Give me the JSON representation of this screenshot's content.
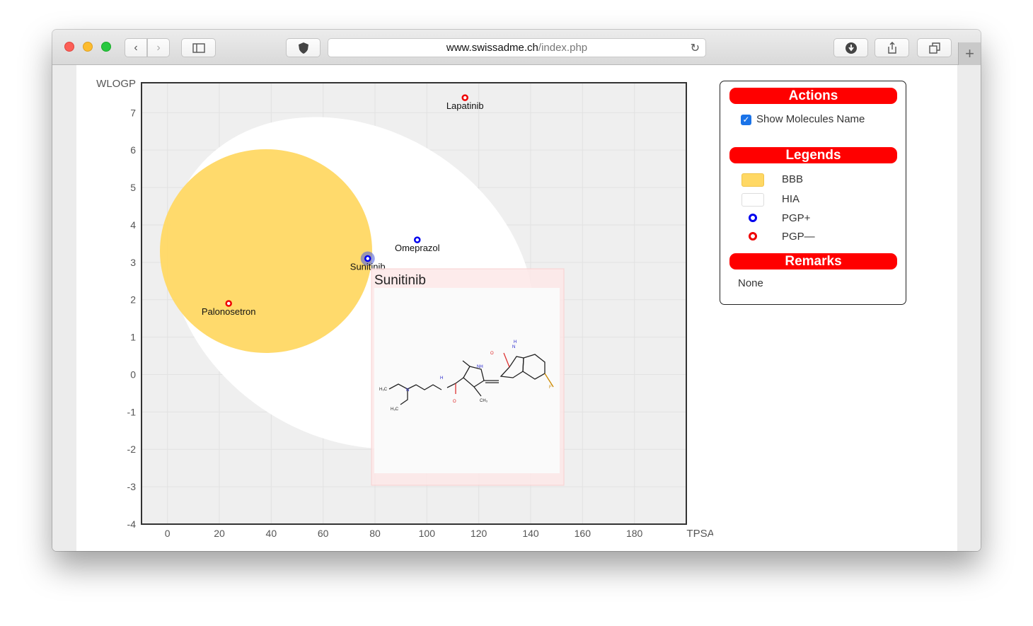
{
  "browser": {
    "url_host": "www.swissadme.ch",
    "url_path": "/index.php"
  },
  "chart_data": {
    "type": "scatter",
    "xlabel": "TPSA",
    "ylabel": "WLOGP",
    "xlim": [
      -10,
      200
    ],
    "ylim": [
      -4,
      7.8
    ],
    "xticks": [
      0,
      20,
      40,
      60,
      80,
      100,
      120,
      140,
      160,
      180
    ],
    "yticks": [
      -4,
      -3,
      -2,
      -1,
      0,
      1,
      2,
      3,
      4,
      5,
      6,
      7
    ],
    "grid": true,
    "regions": [
      {
        "name": "HIA",
        "shape": "ellipse",
        "color": "#ffffff"
      },
      {
        "name": "BBB",
        "shape": "ellipse",
        "color": "#ffd864"
      }
    ],
    "points": [
      {
        "name": "Lapatinib",
        "x": 114.7,
        "y": 7.4,
        "pgp": "PGP-"
      },
      {
        "name": "Omeprazol",
        "x": 96.3,
        "y": 3.6,
        "pgp": "PGP+"
      },
      {
        "name": "Sunitinib",
        "x": 77.2,
        "y": 3.1,
        "pgp": "PGP+"
      },
      {
        "name": "Palonosetron",
        "x": 23.6,
        "y": 1.9,
        "pgp": "PGP-"
      }
    ],
    "colors": {
      "PGP+": "#0000ee",
      "PGP-": "#ee0000",
      "BBB": "#ffd864",
      "HIA": "#ffffff"
    }
  },
  "tooltip": {
    "title": "Sunitinib",
    "structure_labels": [
      "H₃C",
      "NH",
      "N",
      "H",
      "O",
      "F",
      "CH₃",
      "H₃C",
      "N",
      "H",
      "O"
    ]
  },
  "panel": {
    "actions": {
      "title": "Actions",
      "show_names_label": "Show Molecules Name",
      "show_names_checked": true
    },
    "legends": {
      "title": "Legends",
      "items": [
        {
          "label": "BBB",
          "swatch": "#ffd864"
        },
        {
          "label": "HIA",
          "swatch": "#ffffff"
        },
        {
          "label": "PGP+",
          "swatch": "#0000ee"
        },
        {
          "label": "PGP—",
          "swatch": "#ee0000"
        }
      ]
    },
    "remarks": {
      "title": "Remarks",
      "text": "None"
    }
  }
}
